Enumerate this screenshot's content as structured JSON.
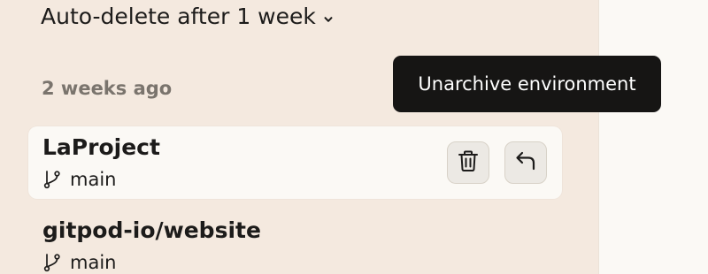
{
  "settings": {
    "auto_delete_label": "Auto-delete after 1 week"
  },
  "group": {
    "label": "2 weeks ago"
  },
  "environments": [
    {
      "name": "LaProject",
      "branch": "main",
      "highlighted": true
    },
    {
      "name": "gitpod-io/website",
      "branch": "main",
      "highlighted": false
    }
  ],
  "tooltip": {
    "text": "Unarchive environment"
  },
  "icons": {
    "dropdown": "chevron-down-icon",
    "branch": "git-branch-icon",
    "delete": "trash-icon",
    "unarchive": "undo-arrow-icon"
  },
  "colors": {
    "panel_bg": "#f4e9df",
    "page_bg": "#fbf9f5",
    "tooltip_bg": "#161514",
    "text": "#1c1b1a",
    "muted_text": "#7a746d"
  }
}
